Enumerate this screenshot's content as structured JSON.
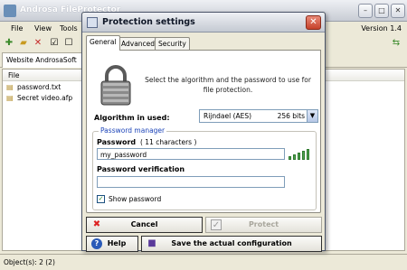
{
  "main_window": {
    "title": "Androsa FileProtector",
    "version": "Version 1.4",
    "menu": [
      "File",
      "View",
      "Tools"
    ],
    "tab_label": "Website AndrosaSoft",
    "file_header": "File",
    "files": [
      "password.txt",
      "Secret video.afp"
    ],
    "status": "Object(s): 2 (2)"
  },
  "dialog": {
    "title": "Protection settings",
    "close_glyph": "✕",
    "tabs": [
      "General",
      "Advanced",
      "Security"
    ],
    "active_tab": "General",
    "info_text": "Select the algorithm and the password to use for file protection.",
    "algorithm_label": "Algorithm in used:",
    "algorithm_value": "Rijndael (AES)",
    "algorithm_bits": "256 bits",
    "password_manager_legend": "Password manager",
    "password_label": "Password",
    "password_chars": "( 11 characters )",
    "password_value": "my_password",
    "verification_label": "Password verification",
    "verification_value": "",
    "show_password_label": "Show password",
    "show_password_checked": true,
    "strength_bars": 5,
    "buttons": {
      "cancel": "Cancel",
      "protect": "Protect",
      "help": "Help",
      "save": "Save the actual configuration"
    }
  },
  "colors": {
    "window_bg": "#ece9d8",
    "legend_blue": "#1c44b8",
    "strength_green": "#4ea24e",
    "close_red": "#c5412a"
  },
  "icons": {
    "lock": "padlock-icon",
    "cancel": "red-x-icon",
    "protect": "check-icon",
    "help": "help-icon",
    "save": "floppy-icon"
  }
}
